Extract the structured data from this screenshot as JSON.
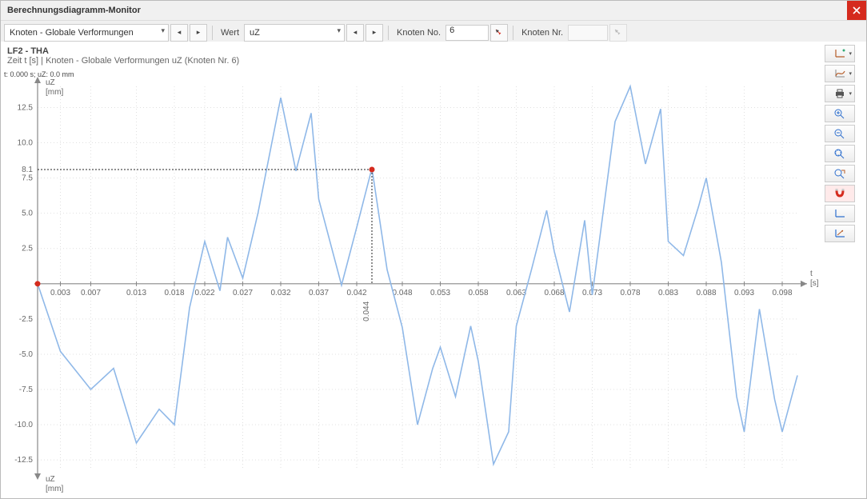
{
  "window": {
    "title": "Berechnungsdiagramm-Monitor"
  },
  "toolbar": {
    "param_select": "Knoten - Globale Verformungen",
    "value_label": "Wert",
    "value_select": "uZ",
    "node_label": "Knoten No.",
    "node_value": "6",
    "node_nr_label": "Knoten Nr."
  },
  "chart_header": {
    "line1": "LF2 - THA",
    "line2": "Zeit t [s] | Knoten - Globale Verformungen uZ (Knoten Nr. 6)",
    "cursor": "t: 0.000 s; uZ: 0.0 mm"
  },
  "axes": {
    "y_name": "uZ",
    "y_unit": "[mm]",
    "x_name": "t",
    "x_unit": "[s]"
  },
  "pick": {
    "x_label": "0.044",
    "y_label": "8.1"
  },
  "chart_data": {
    "type": "line",
    "title": "LF2 - THA",
    "xlabel": "t [s]",
    "ylabel": "uZ [mm]",
    "xlim": [
      0.0,
      0.1
    ],
    "ylim": [
      -13.0,
      14.0
    ],
    "x_ticks": [
      0.003,
      0.007,
      0.013,
      0.018,
      0.022,
      0.027,
      0.032,
      0.037,
      0.042,
      0.048,
      0.053,
      0.058,
      0.063,
      0.068,
      0.073,
      0.078,
      0.083,
      0.088,
      0.093,
      0.098
    ],
    "y_ticks": [
      -12.5,
      -10.0,
      -7.5,
      -5.0,
      -2.5,
      2.5,
      5.0,
      7.5,
      10.0,
      12.5
    ],
    "marker": {
      "x": 0.044,
      "y": 8.1
    },
    "series": [
      {
        "name": "uZ",
        "values_x": [
          0.0,
          0.003,
          0.007,
          0.01,
          0.013,
          0.016,
          0.018,
          0.02,
          0.022,
          0.024,
          0.025,
          0.027,
          0.029,
          0.032,
          0.034,
          0.036,
          0.037,
          0.04,
          0.042,
          0.044,
          0.046,
          0.048,
          0.05,
          0.052,
          0.053,
          0.055,
          0.057,
          0.058,
          0.06,
          0.062,
          0.063,
          0.065,
          0.067,
          0.068,
          0.07,
          0.072,
          0.073,
          0.076,
          0.078,
          0.08,
          0.082,
          0.083,
          0.085,
          0.087,
          0.088,
          0.09,
          0.092,
          0.093,
          0.095,
          0.097,
          0.098,
          0.1
        ],
        "values_y": [
          0.0,
          -4.8,
          -7.5,
          -6.0,
          -11.3,
          -8.9,
          -10.0,
          -1.7,
          3.0,
          -0.5,
          3.3,
          0.4,
          5.0,
          13.2,
          8.0,
          12.1,
          6.0,
          -0.1,
          4.0,
          8.2,
          1.0,
          -3.1,
          -10.0,
          -6.0,
          -4.5,
          -8.0,
          -3.0,
          -5.5,
          -12.8,
          -10.5,
          -3.0,
          1.0,
          5.2,
          2.3,
          -2.0,
          4.5,
          -0.8,
          11.5,
          14.0,
          8.5,
          12.4,
          3.0,
          2.0,
          5.5,
          7.5,
          1.5,
          -8.0,
          -10.5,
          -1.8,
          -8.2,
          -10.5,
          -6.5
        ]
      }
    ]
  },
  "sidetools": {
    "names": [
      "axes-settings",
      "curve-add",
      "print",
      "zoom-in",
      "zoom-out",
      "zoom-extents",
      "zoom-pan",
      "magnet-snap",
      "axes-reset",
      "axes-fit"
    ]
  }
}
